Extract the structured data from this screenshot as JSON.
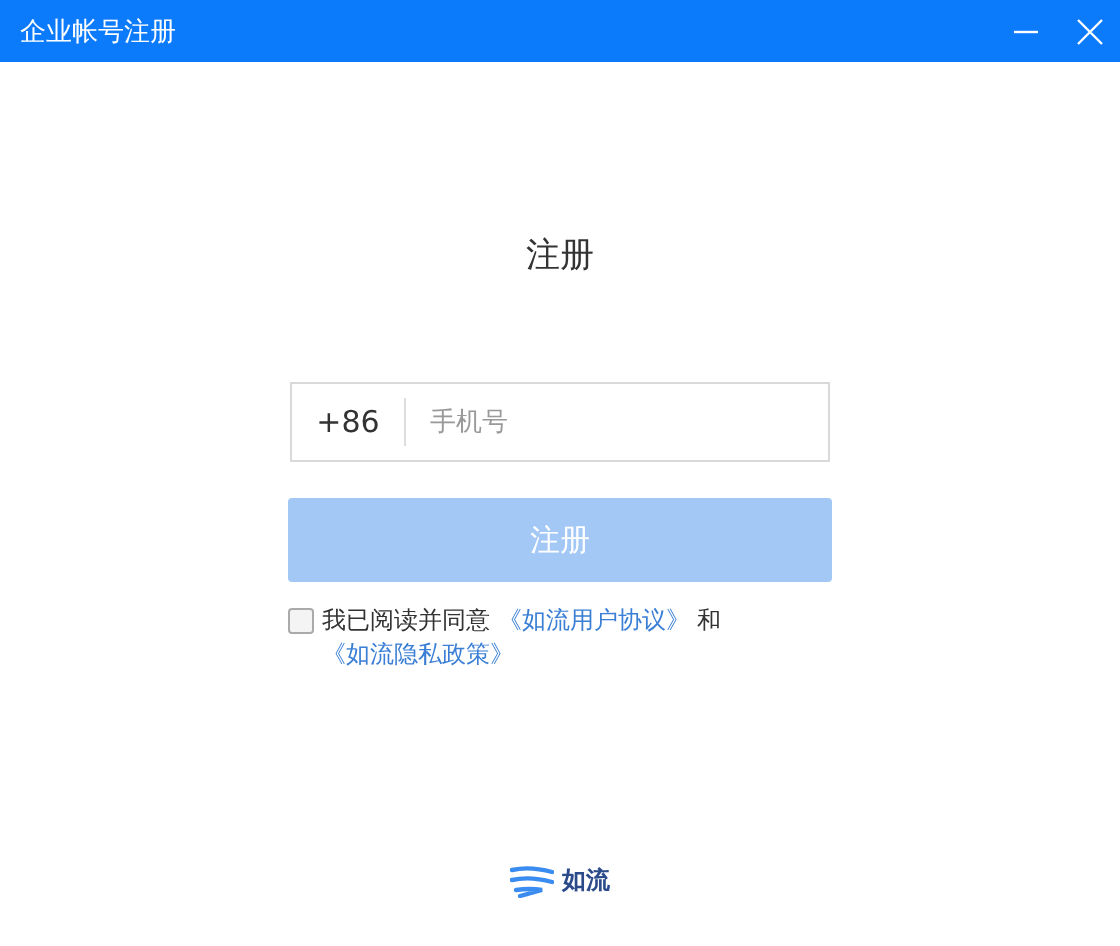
{
  "window": {
    "title": "企业帐号注册"
  },
  "heading": "注册",
  "phone": {
    "country_code": "+86",
    "placeholder": "手机号"
  },
  "submit": {
    "label": "注册",
    "disabled": true
  },
  "agreement": {
    "checked": false,
    "text": "我已阅读并同意",
    "links": [
      {
        "label": "《如流用户协议》"
      },
      {
        "label": "《如流隐私政策》"
      }
    ],
    "joiner": "和"
  },
  "logo": {
    "name": "如流"
  }
}
